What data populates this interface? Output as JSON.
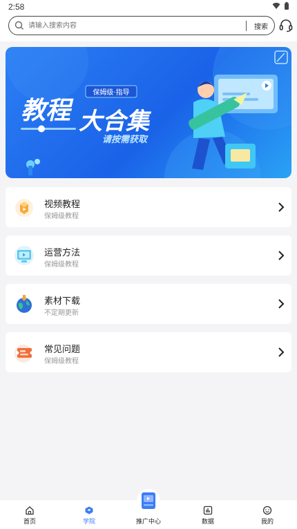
{
  "status": {
    "time": "2:58"
  },
  "search": {
    "placeholder": "请输入搜索内容",
    "button_label": "搜索"
  },
  "banner": {
    "tag": "保姆级·指导",
    "title_line1": "教程",
    "title_line2": "大合集",
    "subtitle": "请按需获取"
  },
  "menu": [
    {
      "title": "视频教程",
      "subtitle": "保姆级教程",
      "icon": "video-box-icon"
    },
    {
      "title": "运营方法",
      "subtitle": "保姆级教程",
      "icon": "monitor-icon"
    },
    {
      "title": "素材下载",
      "subtitle": "不定期更新",
      "icon": "globe-download-icon"
    },
    {
      "title": "常见问题",
      "subtitle": "保姆级教程",
      "icon": "ticket-icon"
    }
  ],
  "tabs": [
    {
      "label": "首页",
      "icon": "home-icon"
    },
    {
      "label": "学院",
      "icon": "academy-icon",
      "active": true
    },
    {
      "label": "推广中心",
      "icon": "promo-center-icon"
    },
    {
      "label": "数据",
      "icon": "data-icon"
    },
    {
      "label": "我的",
      "icon": "profile-icon"
    }
  ],
  "colors": {
    "accent": "#3d7cf5",
    "banner_blue": "#1a62e8",
    "banner_title": "#ffffff"
  }
}
